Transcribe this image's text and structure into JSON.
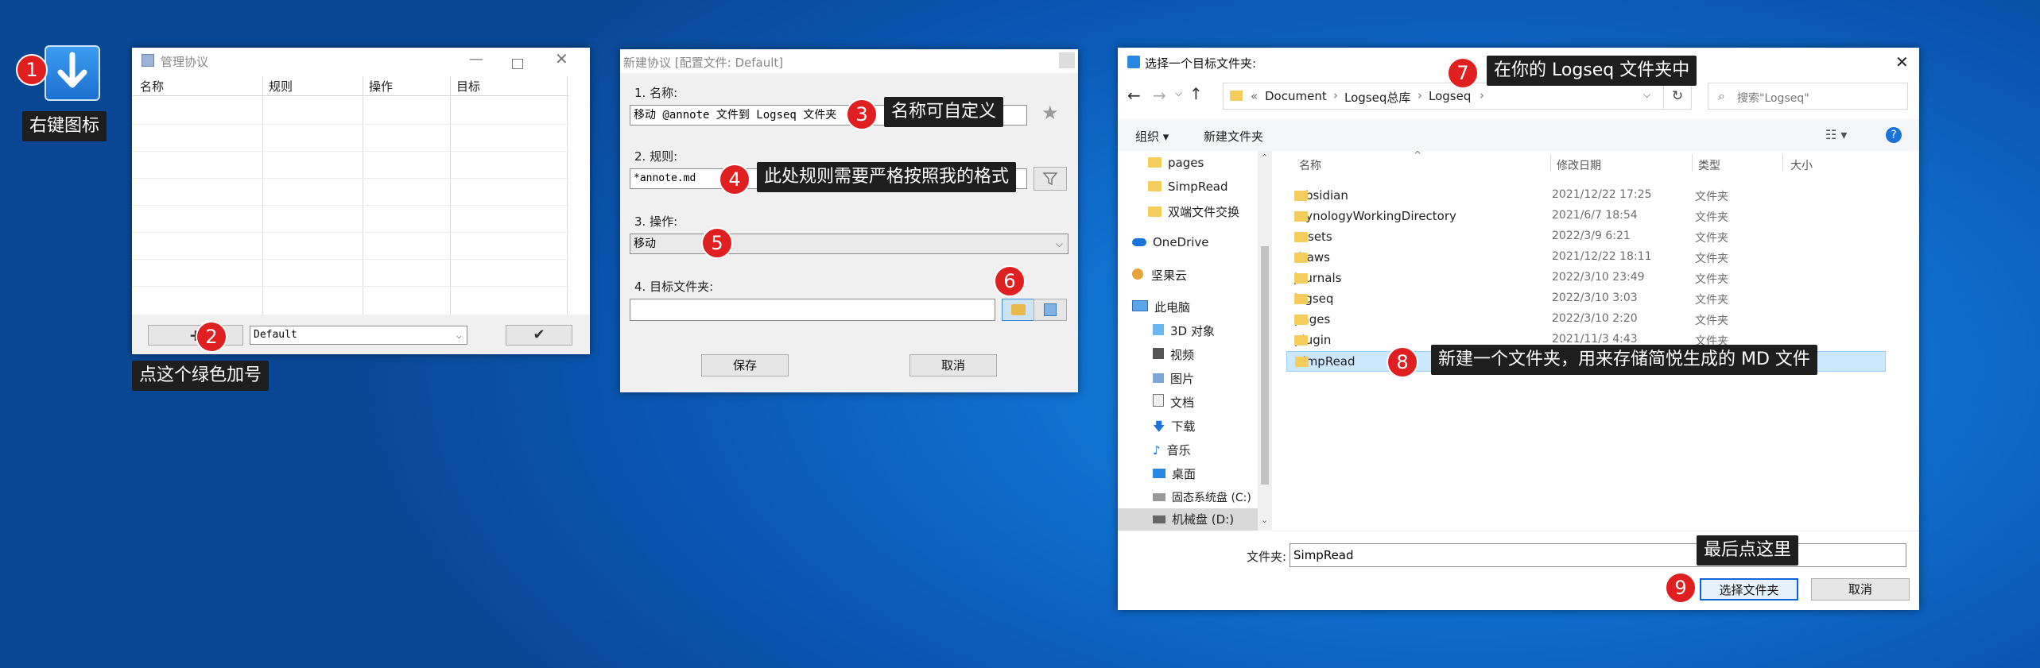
{
  "desktop": {
    "icon_badge": "1",
    "icon_tip": "右键图标"
  },
  "manage_window": {
    "title": "管理协议",
    "columns": [
      "名称",
      "规则",
      "操作",
      "目标"
    ],
    "profile_select": "Default",
    "add_badge": "2",
    "add_tip": "点这个绿色加号"
  },
  "new_window": {
    "title": "新建协议 [配置文件: Default]",
    "name_label": "1. 名称:",
    "name_value": "移动 @annote 文件到 Logseq 文件夹",
    "rule_label": "2. 规则:",
    "rule_value": "*annote.md",
    "action_label": "3. 操作:",
    "action_value": "移动",
    "target_label": "4. 目标文件夹:",
    "target_value": "",
    "save_label": "保存",
    "cancel_label": "取消",
    "badge3": "3",
    "tip3": "名称可自定义",
    "badge4": "4",
    "tip4": "此处规则需要严格按照我的格式",
    "badge5": "5",
    "badge6": "6"
  },
  "folder_dialog": {
    "title": "选择一个目标文件夹:",
    "breadcrumb": [
      "Document",
      "Logseq总库",
      "Logseq"
    ],
    "breadcrumb_prefix": "«",
    "search_placeholder": "搜索\"Logseq\"",
    "organize_label": "组织 ▾",
    "new_folder_label": "新建文件夹",
    "columns": [
      "名称",
      "修改日期",
      "类型",
      "大小"
    ],
    "nav": [
      "pages",
      "SimpRead",
      "双端文件交换",
      "OneDrive",
      "坚果云",
      "此电脑",
      "3D 对象",
      "视频",
      "图片",
      "文档",
      "下载",
      "音乐",
      "桌面",
      "固态系统盘 (C:)",
      "机械盘 (D:)"
    ],
    "files": [
      {
        "name": ".obsidian",
        "date": "2021/12/22 17:25",
        "type": "文件夹"
      },
      {
        "name": ".SynologyWorkingDirectory",
        "date": "2021/6/7 18:54",
        "type": "文件夹"
      },
      {
        "name": "assets",
        "date": "2022/3/9 6:21",
        "type": "文件夹"
      },
      {
        "name": "draws",
        "date": "2021/12/22 18:11",
        "type": "文件夹"
      },
      {
        "name": "journals",
        "date": "2022/3/10 23:49",
        "type": "文件夹"
      },
      {
        "name": "logseq",
        "date": "2022/3/10 3:03",
        "type": "文件夹"
      },
      {
        "name": "pages",
        "date": "2022/3/10 2:20",
        "type": "文件夹"
      },
      {
        "name": "plugin",
        "date": "2021/11/3 4:43",
        "type": "文件夹"
      },
      {
        "name": "SimpRead",
        "date": "",
        "type": ""
      }
    ],
    "folder_label": "文件夹:",
    "folder_value": "SimpRead",
    "select_label": "选择文件夹",
    "cancel_label": "取消",
    "badge7": "7",
    "tip7": "在你的 Logseq 文件夹中",
    "badge8": "8",
    "tip8": "新建一个文件夹，用来存储简悦生成的 MD 文件",
    "badge9": "9",
    "tip9": "最后点这里"
  },
  "colors": {
    "badge": "#e02020",
    "tip_bg": "#1e1e1e",
    "selection": "#cce8ff",
    "folder": "#f5cd5c"
  }
}
